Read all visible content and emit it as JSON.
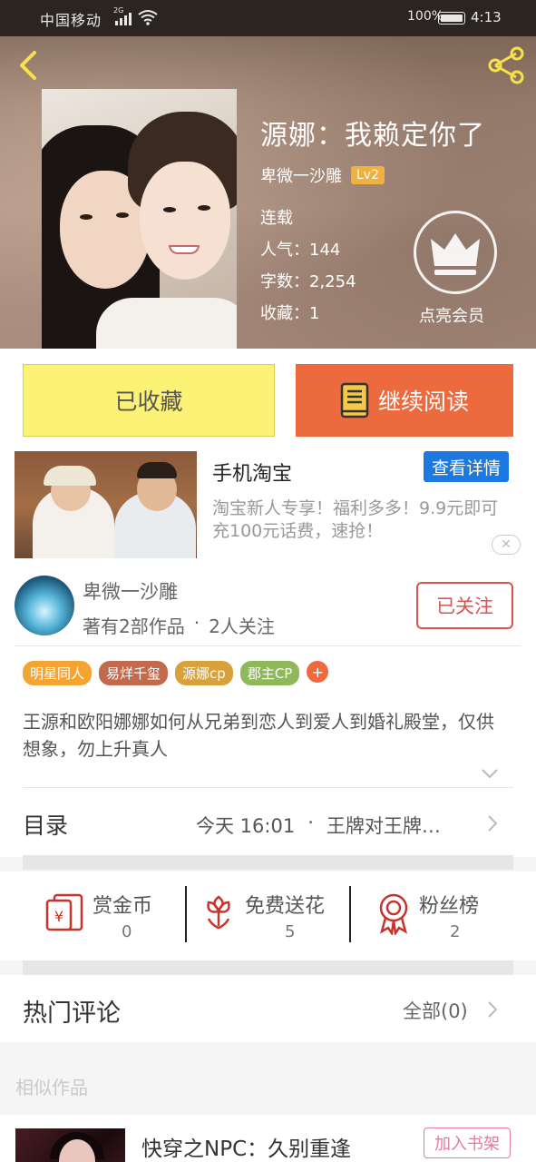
{
  "status_bar": {
    "carrier": "中国移动",
    "network": "2G",
    "battery": "100%",
    "time": "4:13"
  },
  "book": {
    "title": "源娜：我赖定你了",
    "author": "卑微一沙雕",
    "author_level": "Lv2",
    "status": "连载",
    "popularity": "人气：144",
    "word_count": "字数：2,254",
    "favorites": "收藏：1",
    "vip_label": "点亮会员"
  },
  "actions": {
    "collected_label": "已收藏",
    "read_label": "继续阅读"
  },
  "ad": {
    "title": "手机淘宝",
    "detail_button": "查看详情",
    "description": "淘宝新人专享！福利多多！9.9元即可充100元话费，速抢！",
    "close_icon": "close-icon"
  },
  "author_card": {
    "name": "卑微一沙雕",
    "works": "著有2部作品",
    "separator": "·",
    "followers": "2人关注",
    "follow_button": "已关注"
  },
  "tags": [
    {
      "label": "明星同人",
      "color": "#f4a531"
    },
    {
      "label": "易烊千玺",
      "color": "#c26a4e"
    },
    {
      "label": "源娜cp",
      "color": "#d9a13b"
    },
    {
      "label": "郡主CP",
      "color": "#8fb85a"
    }
  ],
  "tag_add": "+",
  "intro": "王源和欧阳娜娜如何从兄弟到恋人到爱人到婚礼殿堂，仅供想象，勿上升真人",
  "toc": {
    "label": "目录",
    "updated": "今天 16:01",
    "dot": "·",
    "latest_chapter": "王牌对王牌…"
  },
  "rewards": [
    {
      "label": "赏金币",
      "count": "0",
      "icon": "red-envelope-icon"
    },
    {
      "label": "免费送花",
      "count": "5",
      "icon": "flower-icon"
    },
    {
      "label": "粉丝榜",
      "count": "2",
      "icon": "medal-icon"
    }
  ],
  "comments": {
    "title": "热门评论",
    "all_label": "全部(0)"
  },
  "similar": {
    "label": "相似作品",
    "items": [
      {
        "title": "快穿之NPC：久别重逢",
        "add_button": "加入书架"
      }
    ]
  },
  "colors": {
    "accent_orange": "#ec6a3e",
    "collected_yellow": "#fcf276",
    "ad_blue": "#1d78e0",
    "follow_red": "#d9534f",
    "icon_red": "#c8332b"
  }
}
